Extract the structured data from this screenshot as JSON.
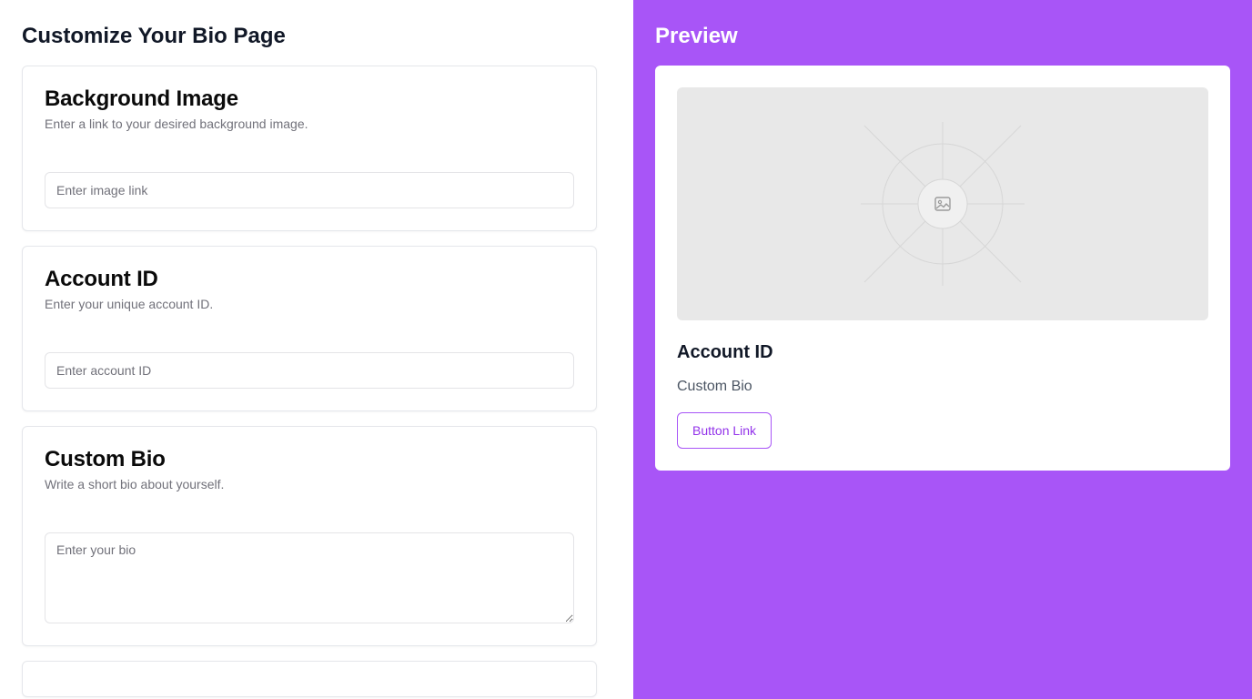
{
  "editor": {
    "title": "Customize Your Bio Page",
    "background_image": {
      "title": "Background Image",
      "description": "Enter a link to your desired background image.",
      "placeholder": "Enter image link",
      "value": ""
    },
    "account_id": {
      "title": "Account ID",
      "description": "Enter your unique account ID.",
      "placeholder": "Enter account ID",
      "value": ""
    },
    "custom_bio": {
      "title": "Custom Bio",
      "description": "Write a short bio about yourself.",
      "placeholder": "Enter your bio",
      "value": ""
    }
  },
  "preview": {
    "title": "Preview",
    "image_icon": "image-icon",
    "account_id": "Account ID",
    "bio": "Custom Bio",
    "button_label": "Button Link"
  },
  "colors": {
    "accent": "#a855f7",
    "accent_text": "#9333ea",
    "card_border": "#e5e7eb",
    "placeholder_bg": "#e8e8e8"
  }
}
